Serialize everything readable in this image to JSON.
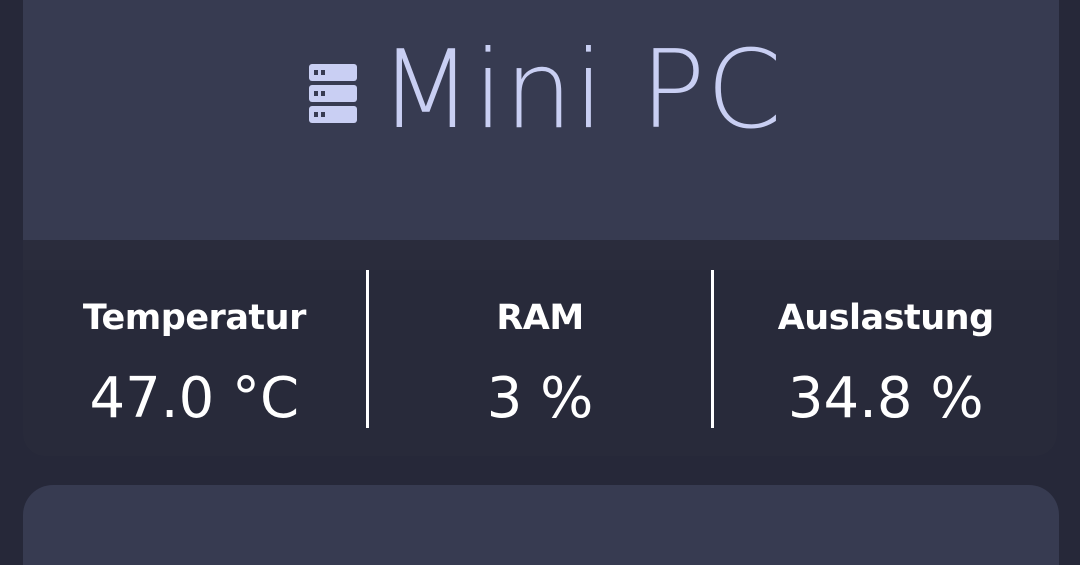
{
  "header": {
    "icon": "server-icon",
    "title": "Mini PC"
  },
  "stats": [
    {
      "label": "Temperatur",
      "value": "47.0 °C"
    },
    {
      "label": "RAM",
      "value": "3 %"
    },
    {
      "label": "Auslastung",
      "value": "34.8 %"
    }
  ],
  "colors": {
    "background": "#262839",
    "header_card": "#373b51",
    "stats_card": "#282a3a",
    "title_text": "#c9cff3",
    "stat_text": "#ffffff"
  }
}
